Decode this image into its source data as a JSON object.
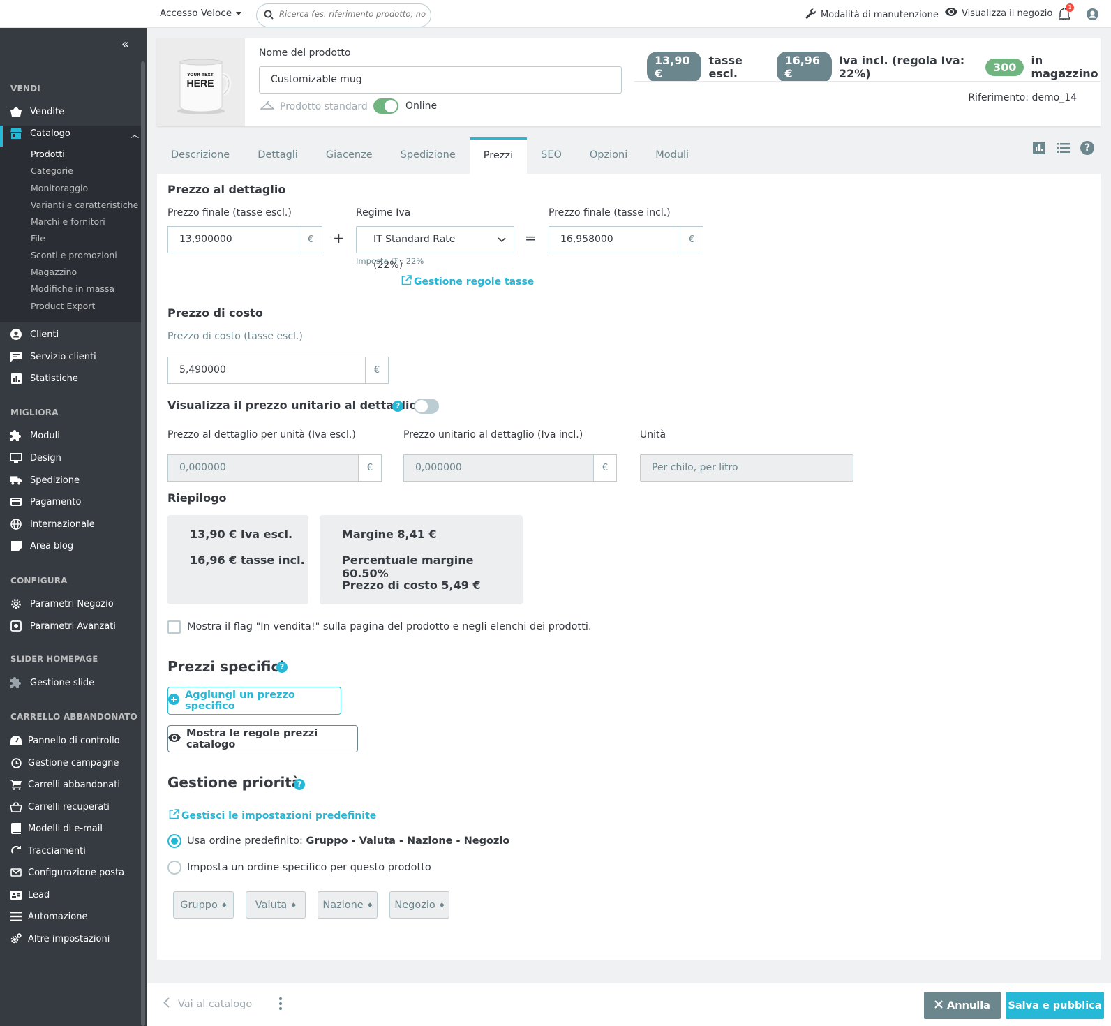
{
  "topbar": {
    "quick_access": "Accesso Veloce",
    "search_placeholder": "Ricerca (es. riferimento prodotto, nom",
    "maintenance": "Modalità di manutenzione",
    "view_shop": "Visualizza il negozio",
    "notifications_count": "1"
  },
  "sidebar": {
    "sections": {
      "vendi": "VENDI",
      "migliora": "MIGLIORA",
      "configura": "CONFIGURA",
      "slider": "SLIDER HOMEPAGE",
      "carrello": "CARRELLO ABBANDONATO"
    },
    "items": {
      "vendite": "Vendite",
      "catalogo": "Catalogo",
      "clienti": "Clienti",
      "servizio_clienti": "Servizio clienti",
      "statistiche": "Statistiche",
      "moduli": "Moduli",
      "design": "Design",
      "spedizione": "Spedizione",
      "pagamento": "Pagamento",
      "internazionale": "Internazionale",
      "area_blog": "Area blog",
      "parametri_negozio": "Parametri Negozio",
      "parametri_avanzati": "Parametri Avanzati",
      "gestione_slide": "Gestione slide",
      "pannello": "Pannello di controllo",
      "campagne": "Gestione campagne",
      "carrelli_abbandonati": "Carrelli abbandonati",
      "carrelli_recuperati": "Carrelli recuperati",
      "modelli_email": "Modelli di e-mail",
      "tracciamenti": "Tracciamenti",
      "config_posta": "Configurazione posta",
      "lead": "Lead",
      "automazione": "Automazione",
      "altre": "Altre impostazioni"
    },
    "catalog_sub": [
      "Prodotti",
      "Categorie",
      "Monitoraggio",
      "Varianti e caratteristiche",
      "Marchi e fornitori",
      "File",
      "Sconti e promozioni",
      "Magazzino",
      "Modifiche in massa",
      "Product Export"
    ]
  },
  "product": {
    "thumb_text_1": "YOUR TEXT",
    "thumb_text_2": "HERE",
    "name_label": "Nome del prodotto",
    "name_value": "Customizable mug",
    "type": "Prodotto standard",
    "online_label": "Online",
    "price_excl_badge": "13,90 €",
    "price_excl_text": "tasse escl.",
    "price_incl_badge": "16,96 €",
    "price_incl_text": "Iva incl. (regola Iva: 22%)",
    "stock_badge": "300",
    "stock_text": "in magazzino",
    "reference": "Riferimento: demo_14"
  },
  "tabs": [
    "Descrizione",
    "Dettagli",
    "Giacenze",
    "Spedizione",
    "Prezzi",
    "SEO",
    "Opzioni",
    "Moduli"
  ],
  "pricing": {
    "retail_title": "Prezzo al dettaglio",
    "final_excl_label": "Prezzo finale (tasse escl.)",
    "final_excl_value": "13,900000",
    "currency": "€",
    "plus": "+",
    "tax_label": "Regime Iva",
    "tax_value": "IT Standard Rate (22%)",
    "tax_hint": "Imposta IT : 22%",
    "equals": "=",
    "final_incl_label": "Prezzo finale (tasse incl.)",
    "final_incl_value": "16,958000",
    "manage_tax": "Gestione regole tasse",
    "cost_title": "Prezzo di costo",
    "cost_label": "Prezzo di costo (tasse escl.)",
    "cost_value": "5,490000",
    "unit_title": "Visualizza il prezzo unitario al dettaglio",
    "unit_excl_label": "Prezzo al dettaglio per unità (Iva escl.)",
    "unit_excl_value": "0,000000",
    "unit_incl_label": "Prezzo unitario al dettaglio (Iva incl.)",
    "unit_incl_value": "0,000000",
    "unit_label": "Unità",
    "unit_placeholder": "Per chilo, per litro",
    "summary_title": "Riepilogo",
    "summary_excl": "13,90 € Iva escl.",
    "summary_incl": "16,96 € tasse incl.",
    "margin": "Margine 8,41 €",
    "margin_pct": "Percentuale margine 60.50%",
    "cost_summary": "Prezzo di costo 5,49 €",
    "on_sale_label": "Mostra il flag \"In vendita!\" sulla pagina del prodotto e negli elenchi dei prodotti.",
    "specific_title": "Prezzi specifici",
    "add_specific": "Aggiungi un prezzo specifico",
    "show_rules": "Mostra le regole prezzi catalogo",
    "priority_title": "Gestione priorità",
    "manage_defaults": "Gestisci le impostazioni predefinite",
    "use_default_prefix": "Usa ordine predefinito: ",
    "use_default_order": "Gruppo - Valuta - Nazione - Negozio",
    "set_specific": "Imposta un ordine specifico per questo prodotto",
    "priority_selects": [
      "Gruppo",
      "Valuta",
      "Nazione",
      "Negozio"
    ]
  },
  "footer": {
    "back": "Vai al catalogo",
    "cancel": "Annulla",
    "save": "Salva e pubblica"
  },
  "colors": {
    "accent": "#25b9d7",
    "sidebar": "#363a41",
    "badge_grey": "#6c868e",
    "badge_green": "#70b580"
  }
}
